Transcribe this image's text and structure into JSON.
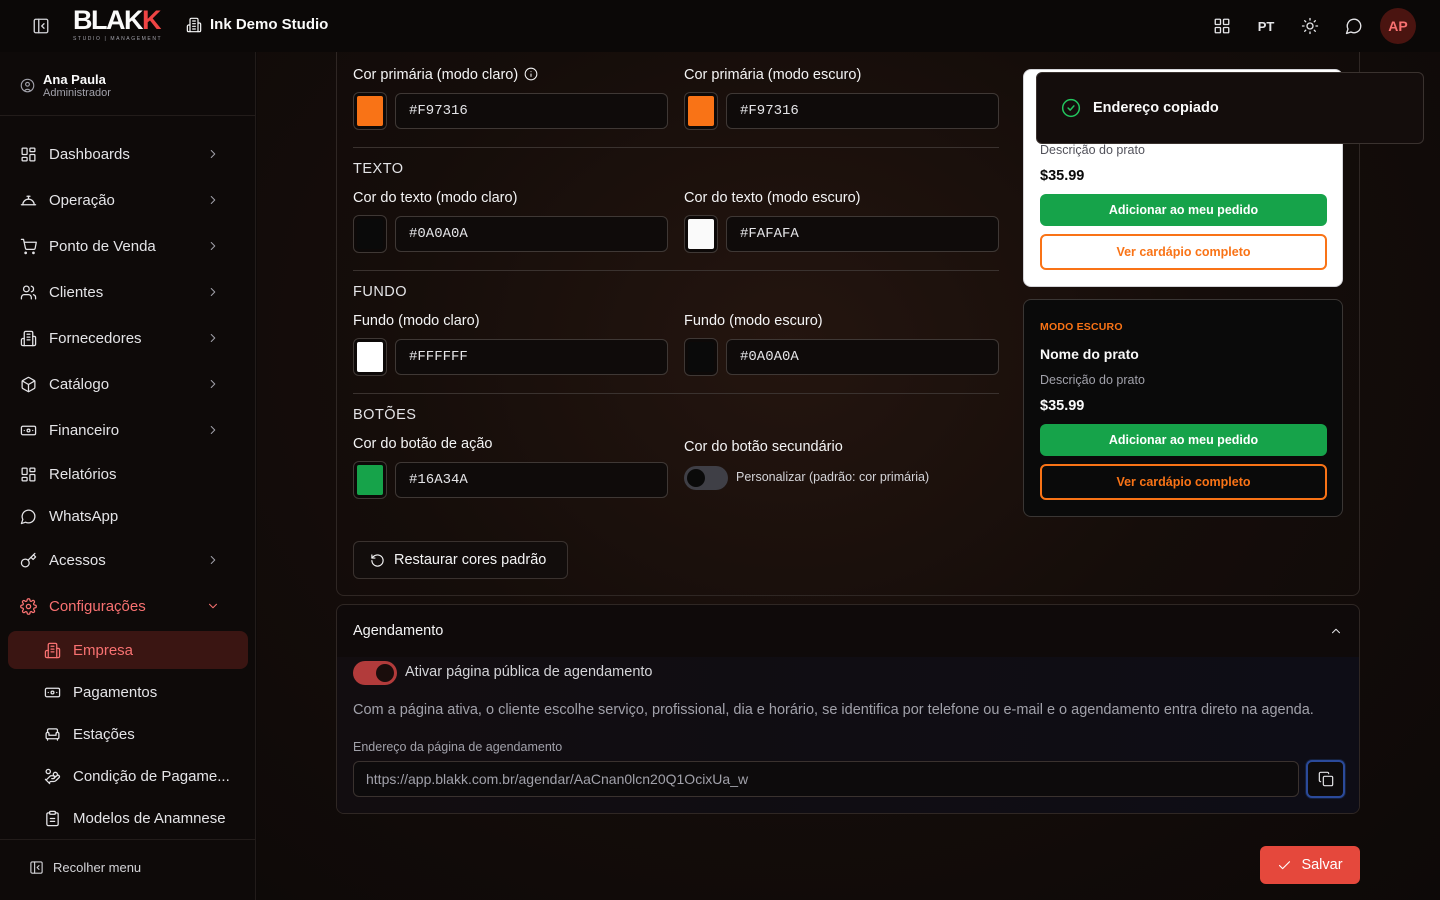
{
  "app": {
    "brand": "BLAKK",
    "brand_tagline": "STUDIO | MANAGEMENT",
    "studio_name": "Ink Demo Studio",
    "language": "PT",
    "avatar_initials": "AP"
  },
  "user": {
    "name": "Ana Paula",
    "role": "Administrador"
  },
  "sidebar": {
    "items": [
      {
        "label": "Dashboards",
        "icon": "grid-icon",
        "has_chevron": true
      },
      {
        "label": "Operação",
        "icon": "operation-icon",
        "has_chevron": true
      },
      {
        "label": "Ponto de Venda",
        "icon": "cart-icon",
        "has_chevron": true
      },
      {
        "label": "Clientes",
        "icon": "users-icon",
        "has_chevron": true
      },
      {
        "label": "Fornecedores",
        "icon": "building-icon",
        "has_chevron": true
      },
      {
        "label": "Catálogo",
        "icon": "box-icon",
        "has_chevron": true
      },
      {
        "label": "Financeiro",
        "icon": "banknote-icon",
        "has_chevron": true
      },
      {
        "label": "Relatórios",
        "icon": "grid-icon",
        "has_chevron": false
      },
      {
        "label": "WhatsApp",
        "icon": "chat-icon",
        "has_chevron": false
      },
      {
        "label": "Acessos",
        "icon": "key-icon",
        "has_chevron": true
      },
      {
        "label": "Configurações",
        "icon": "gear-icon",
        "has_chevron": true,
        "expanded": true
      }
    ],
    "sub_items": [
      {
        "label": "Empresa",
        "icon": "building-icon",
        "active": true
      },
      {
        "label": "Pagamentos",
        "icon": "banknote-icon"
      },
      {
        "label": "Estações",
        "icon": "armchair-icon"
      },
      {
        "label": "Condição de Pagame...",
        "icon": "hand-coins-icon"
      },
      {
        "label": "Modelos de Anamnese",
        "icon": "clipboard-icon"
      }
    ],
    "collapse_label": "Recolher menu"
  },
  "colors_form": {
    "primary_light_label": "Cor primária (modo claro)",
    "primary_light_value": "#F97316",
    "primary_dark_label": "Cor primária (modo escuro)",
    "primary_dark_value": "#F97316",
    "text_section": "TEXTO",
    "text_light_label": "Cor do texto (modo claro)",
    "text_light_value": "#0A0A0A",
    "text_dark_label": "Cor do texto (modo escuro)",
    "text_dark_value": "#FAFAFA",
    "bg_section": "FUNDO",
    "bg_light_label": "Fundo (modo claro)",
    "bg_light_value": "#FFFFFF",
    "bg_dark_label": "Fundo (modo escuro)",
    "bg_dark_value": "#0A0A0A",
    "buttons_section": "BOTÕES",
    "action_btn_label": "Cor do botão de ação",
    "action_btn_value": "#16A34A",
    "secondary_btn_label": "Cor do botão secundário",
    "secondary_toggle_label": "Personalizar (padrão: cor primária)",
    "secondary_toggle_on": false,
    "restore_label": "Restaurar cores padrão"
  },
  "preview_light": {
    "desc": "Descrição do prato",
    "price": "$35.99",
    "primary_btn": "Adicionar ao meu pedido",
    "secondary_btn": "Ver cardápio completo"
  },
  "preview_dark": {
    "mode": "MODO ESCURO",
    "dish": "Nome do prato",
    "desc": "Descrição do prato",
    "price": "$35.99",
    "primary_btn": "Adicionar ao meu pedido",
    "secondary_btn": "Ver cardápio completo"
  },
  "toast": {
    "message": "Endereço copiado"
  },
  "scheduling": {
    "title": "Agendamento",
    "toggle_label": "Ativar página pública de agendamento",
    "toggle_on": true,
    "description": "Com a página ativa, o cliente escolhe serviço, profissional, dia e horário, se identifica por telefone ou e-mail e o agendamento entra direto na agenda.",
    "url_label": "Endereço da página de agendamento",
    "url_value": "https://app.blakk.com.br/agendar/AaCnan0lcn20Q1OcixUa_w"
  },
  "footer": {
    "save_label": "Salvar"
  }
}
